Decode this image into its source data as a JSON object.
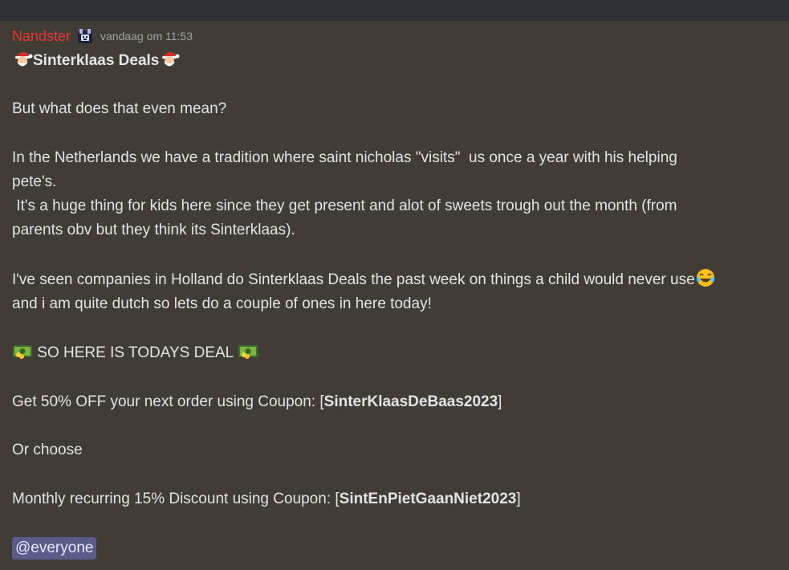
{
  "message": {
    "author": "Nandster",
    "author_color": "#e53935",
    "role_icon": "badge-icon",
    "timestamp": "vandaag om 11:53",
    "title": "Sinterklaas Deals",
    "paragraph_question": "But what does that even mean?",
    "paragraph_tradition_1": "In the Netherlands we have a tradition where saint nicholas \"visits\"  us once a year with his helping",
    "paragraph_tradition_2": "pete's.",
    "paragraph_tradition_3": " It's a huge thing for kids here since they get present and alot of sweets trough out the month (from",
    "paragraph_tradition_4": "parents obv but they think its Sinterklaas).",
    "paragraph_companies_1": "I've seen companies in Holland do Sinterklaas Deals the past week on things a child would never use",
    "paragraph_companies_2": "and i am quite dutch so lets do a couple of ones in here today!",
    "deal_heading": " SO HERE IS TODAYS DEAL ",
    "coupon1_prefix": "Get 50% OFF your next order using Coupon: [",
    "coupon1_code": "SinterKlaasDeBaas2023",
    "coupon1_suffix": "]",
    "or_choose": "Or choose",
    "coupon2_prefix": "Monthly recurring 15% Discount using Coupon: [",
    "coupon2_code": "SintEnPietGaanNiet2023",
    "coupon2_suffix": "]",
    "mention": "@everyone"
  },
  "icons": {
    "santa": "santa-emoji-icon",
    "money": "money-emoji-icon",
    "laughing": "laughing-crying-emoji-icon"
  },
  "colors": {
    "background": "#423c36",
    "top_bar": "#2f3136",
    "mention_bg": "#5b5b8a"
  }
}
